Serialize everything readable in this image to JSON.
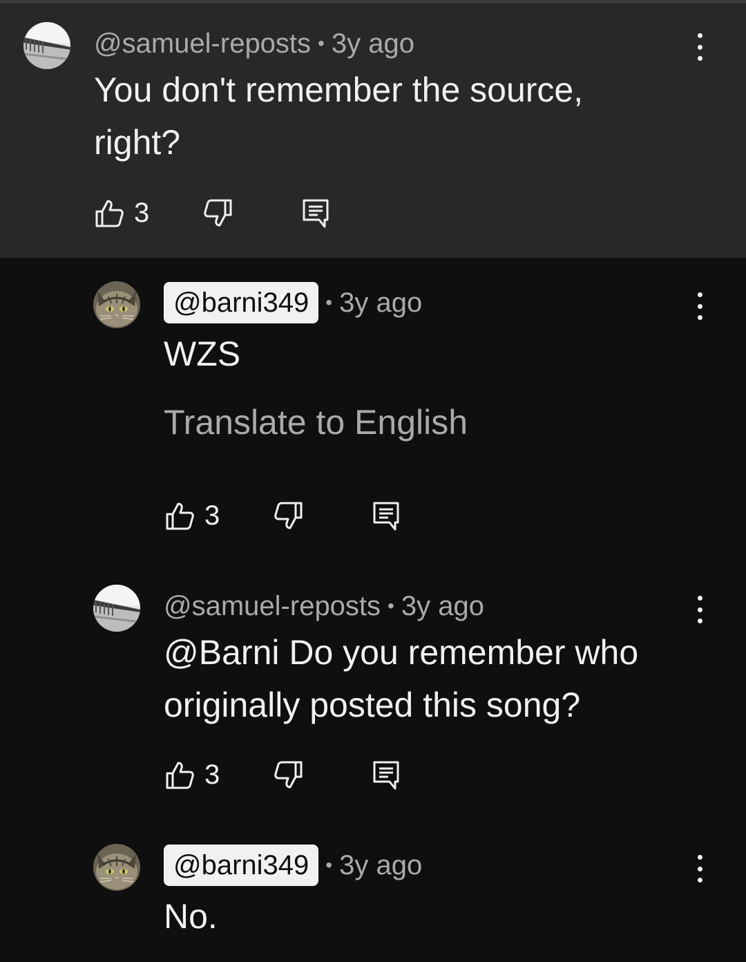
{
  "comments": [
    {
      "author": "@samuel-reposts",
      "separator": "•",
      "time": "3y ago",
      "text": "You don't remember the source, right?",
      "likes": "3",
      "avatar": "bridge-photo-avatar",
      "highlighted": true
    },
    {
      "author": "@barni349",
      "separator": "•",
      "time": "3y ago",
      "text": "WZS",
      "translate": "Translate to English",
      "likes": "3",
      "avatar": "cat-photo-avatar",
      "author_badge": true
    },
    {
      "author": "@samuel-reposts",
      "separator": "•",
      "time": "3y ago",
      "text": "@Barni Do you remember who originally posted this song?",
      "likes": "3",
      "avatar": "bridge-photo-avatar"
    },
    {
      "author": "@barni349",
      "separator": "•",
      "time": "3y ago",
      "text": "No.",
      "avatar": "cat-photo-avatar",
      "author_badge": true
    }
  ],
  "icons": {
    "like": "thumbs-up-icon",
    "dislike": "thumbs-down-icon",
    "reply": "reply-comment-icon",
    "more": "more-vert-icon"
  },
  "colors": {
    "background": "#0f0f0f",
    "highlight": "#282828",
    "primary_text": "#f1f1f1",
    "secondary_text": "#aaaaaa"
  }
}
